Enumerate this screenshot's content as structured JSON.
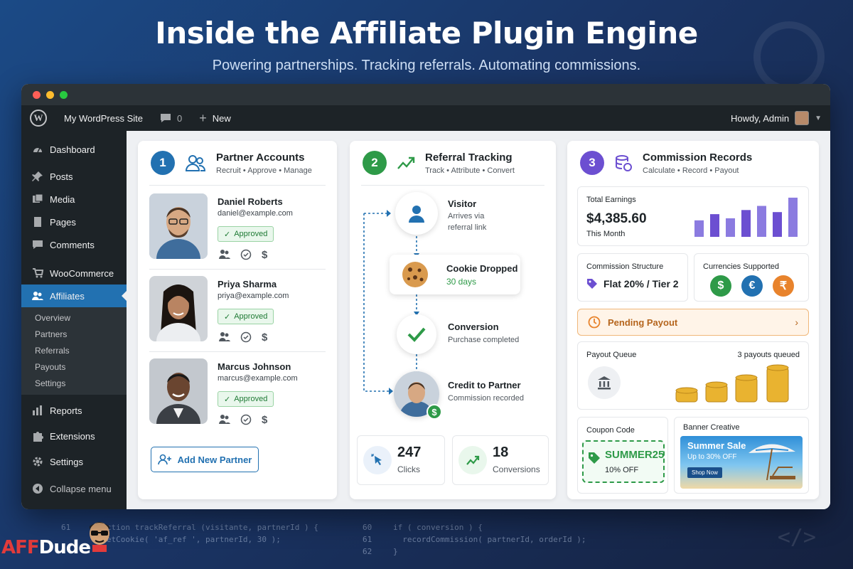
{
  "page": {
    "title": "Inside the Affiliate Plugin Engine",
    "subtitle": "Powering partnerships. Tracking referrals. Automating commissions."
  },
  "background_code": {
    "line_numbers_left": [
      "61"
    ],
    "left_lines": [
      "function trackReferral (visitante, partnerId ) {",
      "  setCookie( 'af_ref ', partnerId, 30 );"
    ],
    "right_numbers": [
      "60",
      "61",
      "62"
    ],
    "right_lines": [
      "if ( conversion ) {",
      "  recordCommission( partnerId, orderId );",
      "}"
    ]
  },
  "brand": {
    "part1": "AFF",
    "part2": "Dude"
  },
  "adminbar": {
    "site_name": "My WordPress Site",
    "comments_count": "0",
    "new_label": "New",
    "howdy": "Howdy, Admin"
  },
  "sidebar": {
    "items": [
      {
        "label": "Dashboard",
        "icon": "dashboard-icon"
      },
      {
        "label": "Posts",
        "icon": "pin-icon"
      },
      {
        "label": "Media",
        "icon": "media-icon"
      },
      {
        "label": "Pages",
        "icon": "pages-icon"
      },
      {
        "label": "Comments",
        "icon": "comment-icon"
      },
      {
        "label": "WooCommerce",
        "icon": "cart-icon"
      },
      {
        "label": "Affiliates",
        "icon": "users-icon"
      },
      {
        "label": "Reports",
        "icon": "bar-chart-icon"
      },
      {
        "label": "Extensions",
        "icon": "puzzle-icon"
      },
      {
        "label": "Settings",
        "icon": "gear-icon"
      },
      {
        "label": "Collapse menu",
        "icon": "collapse-icon"
      }
    ],
    "submenu": [
      "Overview",
      "Partners",
      "Referrals",
      "Payouts",
      "Settings"
    ]
  },
  "partners_card": {
    "number": "1",
    "title": "Partner Accounts",
    "subtitle": "Recruit • Approve • Manage",
    "partners": [
      {
        "name": "Daniel Roberts",
        "email": "daniel@example.com",
        "status": "Approved"
      },
      {
        "name": "Priya Sharma",
        "email": "priya@example.com",
        "status": "Approved"
      },
      {
        "name": "Marcus Johnson",
        "email": "marcus@example.com",
        "status": "Approved"
      }
    ],
    "add_button": "Add New Partner"
  },
  "referral_card": {
    "number": "2",
    "title": "Referral Tracking",
    "subtitle": "Track • Attribute • Convert",
    "steps": [
      {
        "title": "Visitor",
        "desc1": "Arrives via",
        "desc2": "referral link"
      },
      {
        "title": "Cookie Dropped",
        "desc1": "30 days"
      },
      {
        "title": "Conversion",
        "desc1": "Purchase completed"
      },
      {
        "title": "Credit to Partner",
        "desc1": "Commission recorded"
      }
    ],
    "clicks": {
      "value": "247",
      "label": "Clicks"
    },
    "conversions": {
      "value": "18",
      "label": "Conversions"
    }
  },
  "commission_card": {
    "number": "3",
    "title": "Commission Records",
    "subtitle": "Calculate • Record • Payout",
    "total_label": "Total Earnings",
    "total_value": "$4,385.60",
    "period": "This Month",
    "earnings_bars": [
      0.4,
      0.55,
      0.45,
      0.65,
      0.75,
      0.6,
      0.95
    ],
    "structure_label": "Commission Structure",
    "structure_value": "Flat 20% / Tier 2",
    "currencies_label": "Currencies Supported",
    "currencies": [
      {
        "symbol": "$",
        "color": "#2e9a48"
      },
      {
        "symbol": "€",
        "color": "#2271b1"
      },
      {
        "symbol": "₹",
        "color": "#e8832c"
      }
    ],
    "pending_label": "Pending Payout",
    "queue_label": "Payout Queue",
    "queue_count": "3 payouts queued",
    "coupon_label": "Coupon Code",
    "coupon_code": "SUMMER25",
    "coupon_off": "10% OFF",
    "banner_label": "Banner Creative",
    "banner_title": "Summer Sale",
    "banner_sub": "Up to 30% OFF",
    "banner_btn": "Shop Now"
  }
}
